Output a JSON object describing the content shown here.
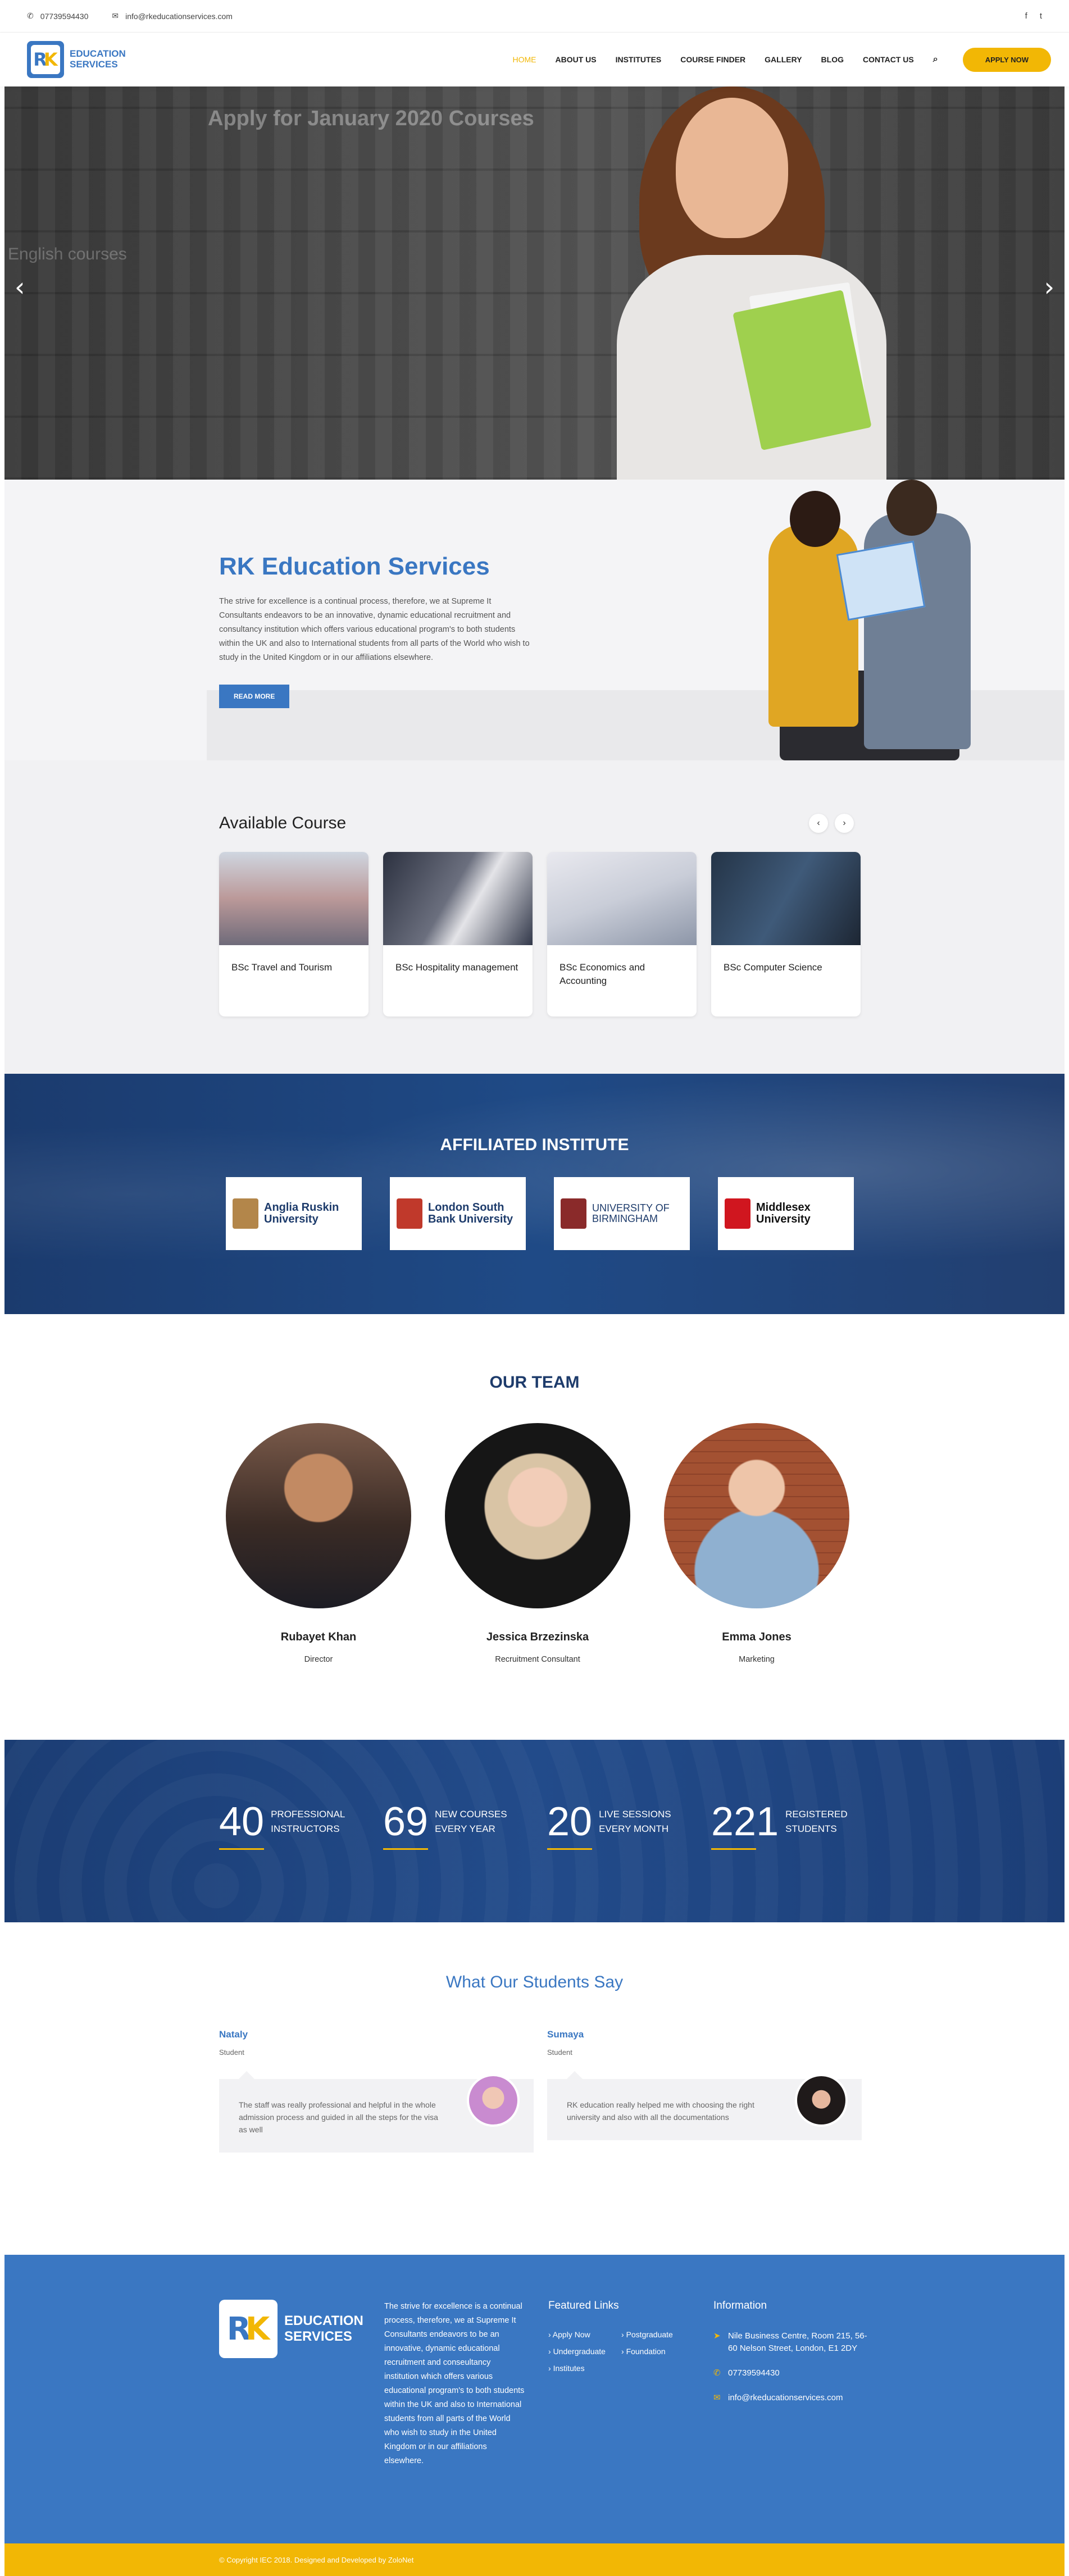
{
  "topbar": {
    "phone": "07739594430",
    "email": "info@rkeducationservices.com",
    "social": [
      "f",
      "t"
    ]
  },
  "header": {
    "logo_text_1": "EDUCATION",
    "logo_text_2": "SERVICES",
    "nav": [
      "HOME",
      "ABOUT US",
      "INSTITUTES",
      "COURSE FINDER",
      "GALLERY",
      "BLOG",
      "CONTACT US"
    ],
    "apply_label": "APPLY NOW"
  },
  "hero": {
    "title": "Apply for January 2020 Courses",
    "subtitle": "English courses",
    "prev": "‹",
    "next": "›"
  },
  "about": {
    "title": "RK Education Services",
    "text": "The strive for excellence is a continual process, therefore, we at Supreme It Consultants endeavors to be an innovative, dynamic educational recruitment and consultancy institution which offers various educational program's to both students within the UK and also to International students from all parts of the World who wish to study in the United Kingdom or in our affiliations elsewhere.",
    "button": "READ MORE"
  },
  "courses": {
    "title": "Available Course",
    "items": [
      "BSc Travel and Tourism",
      "BSc Hospitality management",
      "BSc Economics and Accounting",
      "BSc Computer Science"
    ]
  },
  "affiliated": {
    "title": "AFFILIATED INSTITUTE",
    "institutes": [
      "Anglia Ruskin University",
      "London South Bank University",
      "UNIVERSITY OF BIRMINGHAM",
      "Middlesex University"
    ]
  },
  "team": {
    "title": "OUR TEAM",
    "members": [
      {
        "name": "Rubayet Khan",
        "role": "Director"
      },
      {
        "name": "Jessica Brzezinska",
        "role": "Recruitment Consultant"
      },
      {
        "name": "Emma Jones",
        "role": "Marketing"
      }
    ]
  },
  "stats": [
    {
      "num": "40",
      "l1": "PROFESSIONAL",
      "l2": "INSTRUCTORS"
    },
    {
      "num": "69",
      "l1": "NEW COURSES",
      "l2": "EVERY YEAR"
    },
    {
      "num": "20",
      "l1": "LIVE SESSIONS",
      "l2": "EVERY MONTH"
    },
    {
      "num": "221",
      "l1": "REGISTERED",
      "l2": "STUDENTS"
    }
  ],
  "testimonials": {
    "title": "What Our Students Say",
    "items": [
      {
        "name": "Nataly",
        "role": "Student",
        "text": "The staff was really professional and helpful in the whole admission process and guided in all the steps for the visa as well"
      },
      {
        "name": "Sumaya",
        "role": "Student",
        "text": "RK education really helped me with choosing the right university and also with all the documentations"
      }
    ]
  },
  "footer": {
    "logo_text_1": "EDUCATION",
    "logo_text_2": "SERVICES",
    "about": "The strive for excellence is a continual process, therefore, we at Supreme It Consultants endeavors to be an innovative, dynamic educational recruitment and conseultancy institution which offers various educational program's to both students within the UK and also to International students from all parts of the World who wish to study in the United Kingdom or in our affiliations elsewhere.",
    "links_title": "Featured Links",
    "links": [
      "Apply Now",
      "Postgraduate",
      "Undergraduate",
      "Foundation",
      "Institutes"
    ],
    "info_title": "Information",
    "address": "Nile Business Centre, Room 215, 56-60 Nelson Street, London, E1 2DY",
    "phone": "07739594430",
    "email": "info@rkeducationservices.com",
    "copyright": "© Copyright IEC 2018. Designed and Developed by ZoloNet"
  },
  "colors": {
    "primary": "#3a77c2",
    "accent": "#f2b705",
    "navy": "#1d3b6b"
  }
}
